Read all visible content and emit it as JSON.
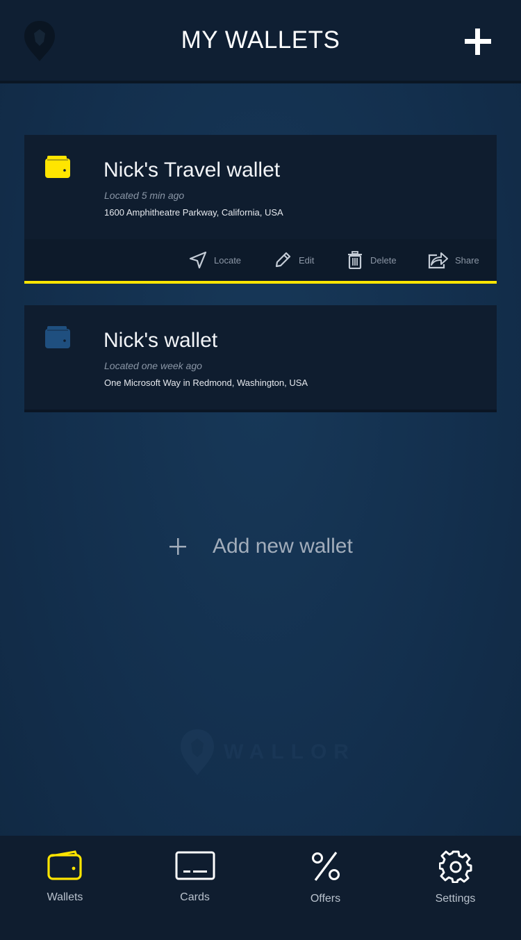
{
  "header": {
    "title": "MY WALLETS"
  },
  "wallets": [
    {
      "name": "Nick's Travel wallet",
      "located": "Located 5 min ago",
      "address": "1600 Amphitheatre Parkway, California, USA",
      "icon_color": "#ffe500",
      "selected": true
    },
    {
      "name": "Nick's wallet",
      "located": "Located one week ago",
      "address": "One Microsoft Way in Redmond, Washington, USA",
      "icon_color": "#1f4f7f",
      "selected": false
    }
  ],
  "actions": {
    "locate": "Locate",
    "edit": "Edit",
    "delete": "Delete",
    "share": "Share"
  },
  "add_wallet": {
    "label": "Add new wallet"
  },
  "watermark": {
    "text": "WALLOR"
  },
  "tabs": [
    {
      "label": "Wallets",
      "icon": "wallet-icon",
      "active": true
    },
    {
      "label": "Cards",
      "icon": "card-icon",
      "active": false
    },
    {
      "label": "Offers",
      "icon": "percent-icon",
      "active": false
    },
    {
      "label": "Settings",
      "icon": "gear-icon",
      "active": false
    }
  ],
  "colors": {
    "accent": "#ffe500",
    "header_bg": "#0f1f33",
    "background": "#132f4d",
    "card_bg": "#0f1d2f",
    "inactive_wallet": "#1f4f7f"
  }
}
